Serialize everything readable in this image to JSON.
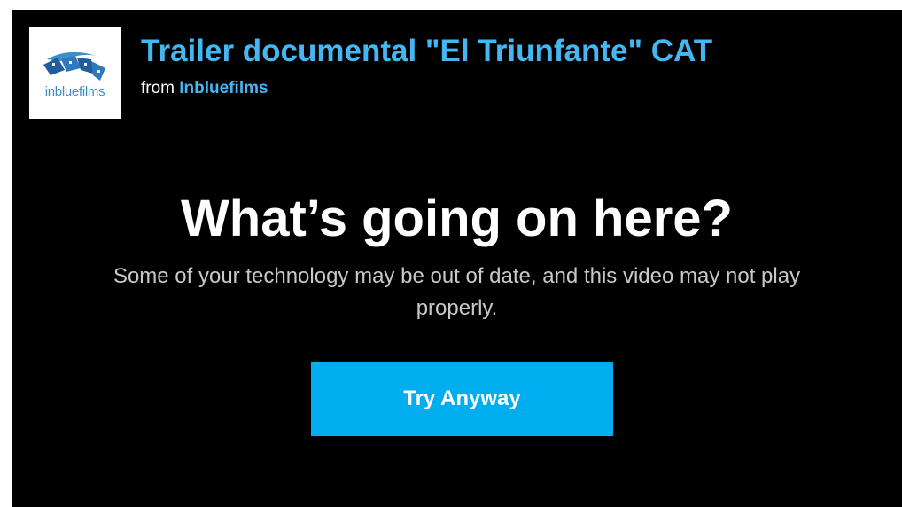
{
  "header": {
    "logo_text": "inbluefilms",
    "video_title": "Trailer documental \"El Triunfante\" CAT",
    "byline_prefix": "from",
    "author": "Inbluefilms"
  },
  "message": {
    "headline": "What’s going on here?",
    "subtext": "Some of your technology may be out of date, and this video may not play properly."
  },
  "actions": {
    "try_anyway_label": "Try Anyway"
  },
  "colors": {
    "background": "#000000",
    "link": "#44b7f2",
    "button": "#00adef",
    "subtext": "#c8c8c8"
  }
}
